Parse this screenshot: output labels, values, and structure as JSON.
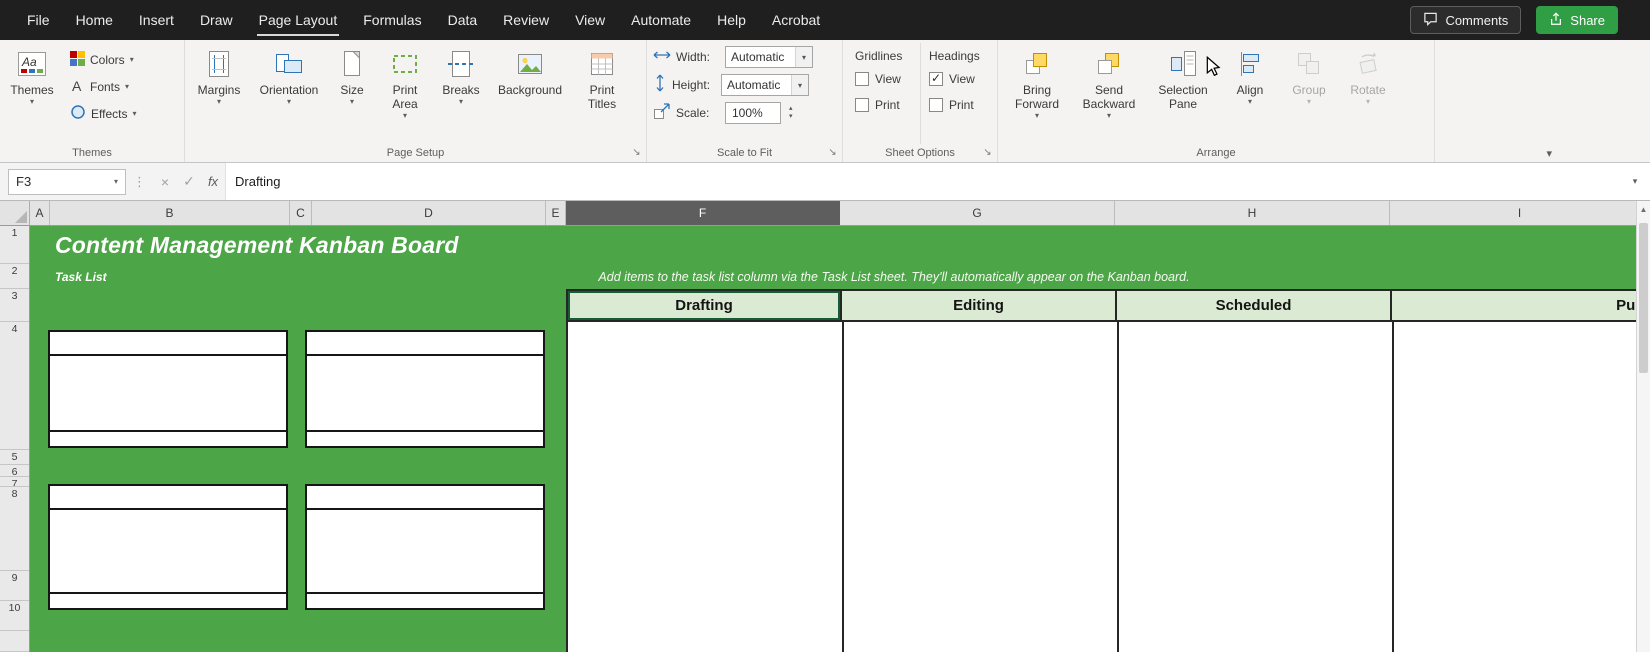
{
  "menubar": {
    "tabs": [
      "File",
      "Home",
      "Insert",
      "Draw",
      "Page Layout",
      "Formulas",
      "Data",
      "Review",
      "View",
      "Automate",
      "Help",
      "Acrobat"
    ],
    "active_tab": "Page Layout",
    "comments_label": "Comments",
    "share_label": "Share"
  },
  "ribbon": {
    "themes": {
      "group_label": "Themes",
      "themes_button": "Themes",
      "colors_label": "Colors",
      "fonts_label": "Fonts",
      "effects_label": "Effects"
    },
    "page_setup": {
      "group_label": "Page Setup",
      "margins": "Margins",
      "orientation": "Orientation",
      "size": "Size",
      "print_area": "Print Area",
      "breaks": "Breaks",
      "background": "Background",
      "print_titles": "Print Titles"
    },
    "scale_to_fit": {
      "group_label": "Scale to Fit",
      "width_label": "Width:",
      "width_value": "Automatic",
      "height_label": "Height:",
      "height_value": "Automatic",
      "scale_label": "Scale:",
      "scale_value": "100%"
    },
    "sheet_options": {
      "group_label": "Sheet Options",
      "gridlines_title": "Gridlines",
      "headings_title": "Headings",
      "view_label": "View",
      "print_label": "Print",
      "gridlines_view_checked": false,
      "gridlines_print_checked": false,
      "headings_view_checked": true,
      "headings_print_checked": false
    },
    "arrange": {
      "group_label": "Arrange",
      "bring_forward": "Bring Forward",
      "send_backward": "Send Backward",
      "selection_pane": "Selection Pane",
      "align": "Align",
      "group": "Group",
      "rotate": "Rotate",
      "disabled_buttons": [
        "Group",
        "Rotate"
      ]
    }
  },
  "formula_bar": {
    "name_box": "F3",
    "fx_label": "fx",
    "value": "Drafting"
  },
  "grid": {
    "col_letters": [
      "A",
      "B",
      "C",
      "D",
      "E",
      "F",
      "G",
      "H",
      "I"
    ],
    "selected_column": "F",
    "selected_cell": "F3",
    "row_numbers": [
      "1",
      "2",
      "3",
      "4",
      "5",
      "6",
      "7",
      "8",
      "9",
      "10"
    ],
    "title": "Content Management Kanban Board",
    "task_list_label": "Task List",
    "instruction": "Add items to the task list column via the Task List sheet. They'll automatically appear on the Kanban board.",
    "kanban_columns": [
      "Drafting",
      "Editing",
      "Scheduled",
      "Published"
    ]
  },
  "icons": {
    "dropdown_arrow": "▾",
    "spinner_up": "▴",
    "spinner_down": "▾",
    "dots": "⋮",
    "cancel": "×",
    "enter": "✓",
    "dialog_launcher": "↘",
    "collapse_ribbon": "▾",
    "scroll_up_arrow": "▲",
    "themes_glyph": "Aa",
    "fonts_glyph": "A"
  },
  "colors": {
    "banner_green": "#4CA546",
    "kanban_header_green": "#DBEAD2",
    "share_green": "#2F9E44",
    "selection_green": "#155E35",
    "grid_border": "#262626"
  }
}
